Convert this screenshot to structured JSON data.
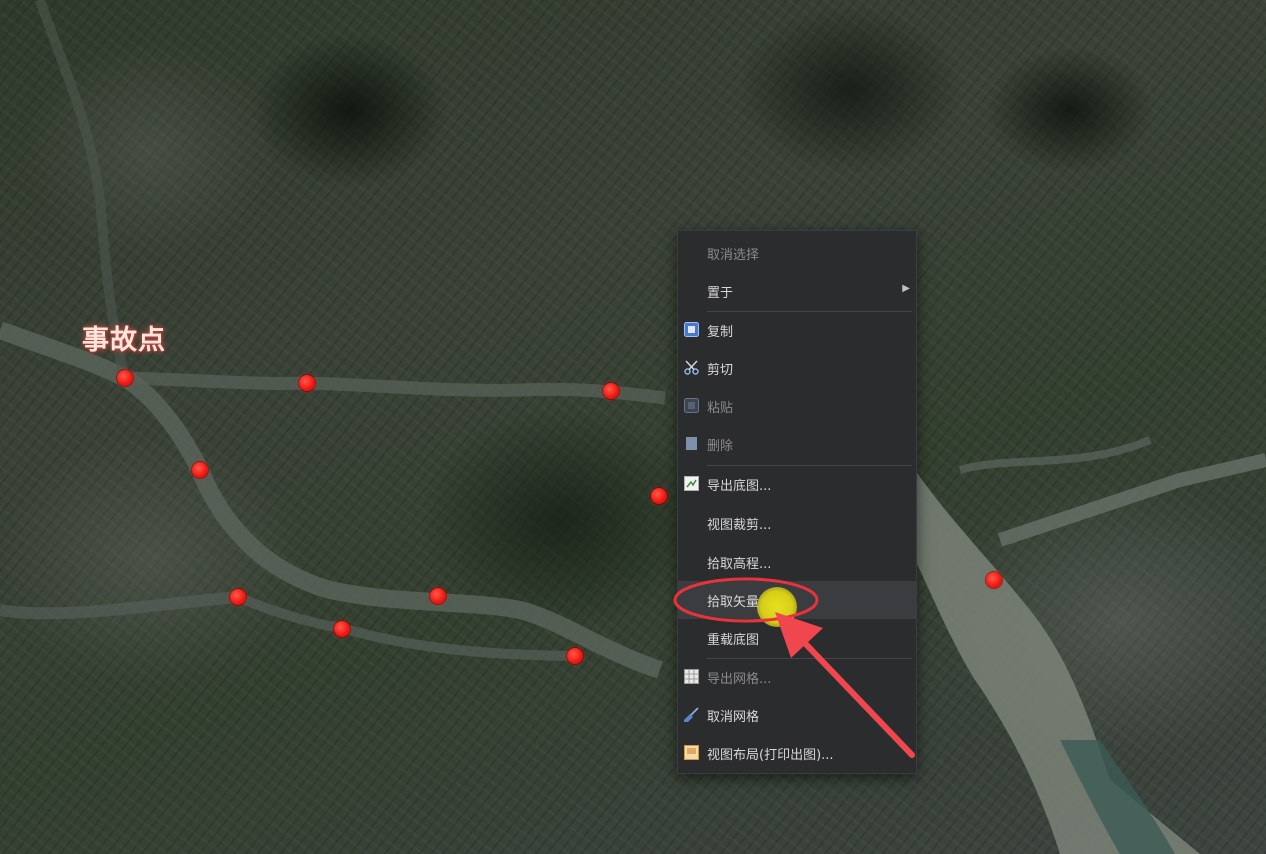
{
  "map": {
    "accident_label": "事故点",
    "marker_color": "#f21a12",
    "markers_count_note": "",
    "river_color": "#5d675e"
  },
  "context_menu": {
    "items": [
      {
        "label": "取消选择",
        "icon": "none",
        "disabled": true
      },
      {
        "label": "置于",
        "icon": "none",
        "submenu": true
      },
      {
        "label": "复制",
        "icon": "copy-icon"
      },
      {
        "label": "剪切",
        "icon": "scissors-icon"
      },
      {
        "label": "粘贴",
        "icon": "paste-icon",
        "disabled": true
      },
      {
        "label": "删除",
        "icon": "delete-icon",
        "disabled": true
      },
      {
        "label": "导出底图...",
        "icon": "export-map-icon"
      },
      {
        "label": "视图裁剪...",
        "icon": "none"
      },
      {
        "label": "拾取高程...",
        "icon": "none"
      },
      {
        "label": "拾取矢量",
        "icon": "none",
        "highlighted": true
      },
      {
        "label": "重载底图",
        "icon": "none"
      },
      {
        "label": "导出网格...",
        "icon": "grid-icon",
        "disabled": true
      },
      {
        "label": "取消网格",
        "icon": "broom-icon"
      },
      {
        "label": "视图布局(打印出图)...",
        "icon": "layout-icon"
      }
    ]
  },
  "annotation": {
    "circle_color": "#e8333d",
    "arrow_color": "#f0474f",
    "cursor_color": "#ece21a"
  }
}
